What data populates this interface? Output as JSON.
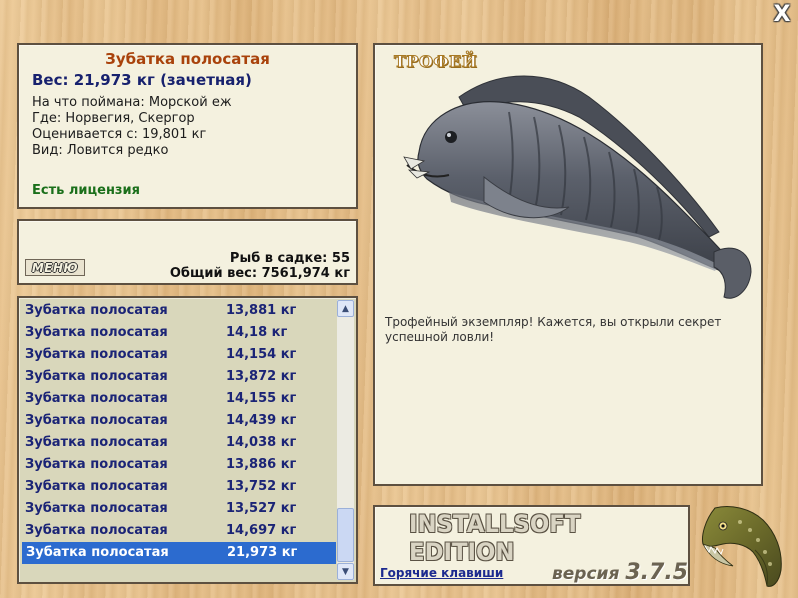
{
  "window": {
    "close_label": "X"
  },
  "info": {
    "title": "Зубатка полосатая",
    "weight": "Вес: 21,973 кг (зачетная)",
    "caught_on": "На что поймана: Морской еж",
    "location": "Где: Норвегия, Скергор",
    "rated_from": "Оценивается с: 19,801 кг",
    "kind": "Вид: Ловится редко",
    "license": "Есть лицензия"
  },
  "summary": {
    "menu_label": "МЕНЮ",
    "fish_in_keepnet": "Рыб в садке: 55",
    "total_weight": "Общий вес: 7561,974 кг"
  },
  "fish_list": {
    "rows": [
      {
        "name": "Зубатка полосатая",
        "weight": "13,881 кг"
      },
      {
        "name": "Зубатка полосатая",
        "weight": "14,18 кг"
      },
      {
        "name": "Зубатка полосатая",
        "weight": "14,154 кг"
      },
      {
        "name": "Зубатка полосатая",
        "weight": "13,872 кг"
      },
      {
        "name": "Зубатка полосатая",
        "weight": "14,155 кг"
      },
      {
        "name": "Зубатка полосатая",
        "weight": "14,439 кг"
      },
      {
        "name": "Зубатка полосатая",
        "weight": "14,038 кг"
      },
      {
        "name": "Зубатка полосатая",
        "weight": "13,886 кг"
      },
      {
        "name": "Зубатка полосатая",
        "weight": "13,752 кг"
      },
      {
        "name": "Зубатка полосатая",
        "weight": "13,527 кг"
      },
      {
        "name": "Зубатка полосатая",
        "weight": "14,697 кг"
      },
      {
        "name": "Зубатка полосатая",
        "weight": "21,973 кг"
      }
    ],
    "selected_index": 11
  },
  "trophy": {
    "label": "ТРОФЕЙ",
    "text": "Трофейный экземпляр! Кажется, вы открыли секрет успешной ловли!"
  },
  "brand": {
    "title": "INSTALLSOFT EDITION",
    "hotkeys_label": "Горячие клавиши",
    "version_label": "версия",
    "version_number": "3.7.5"
  },
  "colors": {
    "panel_bg": "#f4f1df",
    "list_bg": "#d9d7bb",
    "selection": "#2c6bcf",
    "title_orange": "#a9420b",
    "weight_blue": "#17216e",
    "license_green": "#1a6f1a"
  },
  "icons": {
    "close": "close-icon",
    "scroll_up": "chevron-up-icon",
    "scroll_down": "chevron-down-icon",
    "logo": "pike-fish-logo"
  }
}
